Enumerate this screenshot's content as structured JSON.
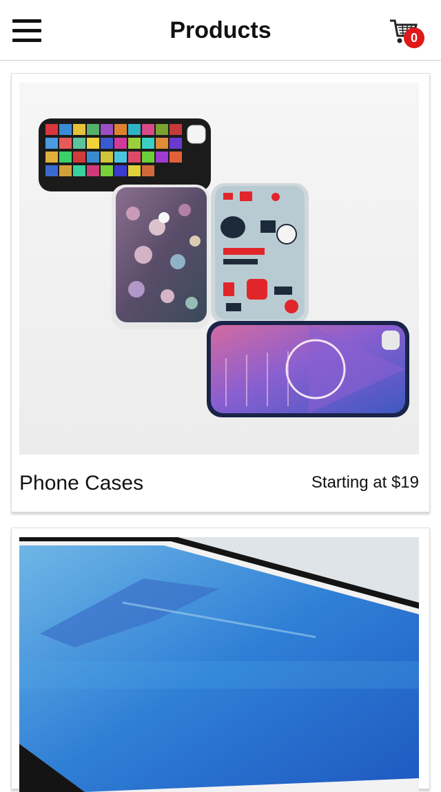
{
  "header": {
    "title": "Products",
    "cart_count": "0"
  },
  "products": [
    {
      "name": "Phone Cases",
      "price": "Starting at $19"
    },
    {
      "name": "",
      "price": ""
    }
  ],
  "colors": {
    "badge": "#e01818",
    "divider": "#cfcfcf"
  }
}
